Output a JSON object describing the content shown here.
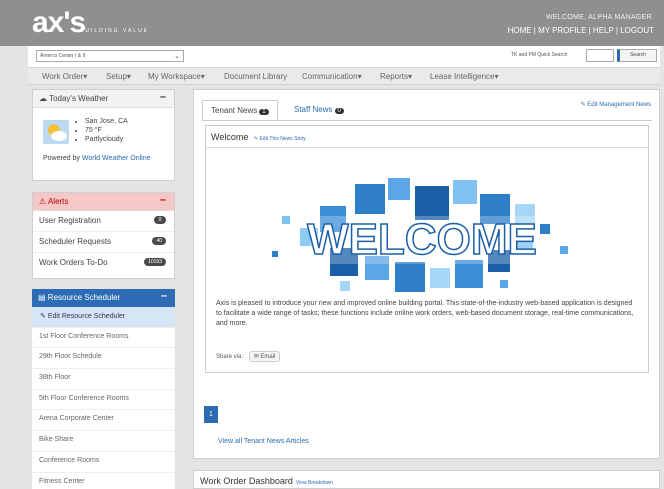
{
  "header": {
    "logo": "ax's",
    "tagline": "BUILDING VALUE",
    "welcome": "WELCOME, ALPHA MANAGER",
    "links": "HOME | MY PROFILE | HELP | LOGOUT"
  },
  "toolbar": {
    "property_select": "Amerco Center I & II",
    "quick_search_label": "TK and PM Quick Search",
    "quick_search_value": "",
    "search_button": "Search"
  },
  "nav": {
    "items": [
      "Work Order▾",
      "Setup▾",
      "My Workspace▾",
      "Document Library",
      "Communication▾",
      "Reports▾",
      "Lease Intelligence▾"
    ]
  },
  "weather": {
    "title": "Today's Weather",
    "city": "San Jose, CA",
    "temp": "75 °F",
    "condition": "Partlycloudy",
    "powered_prefix": "Powered by ",
    "powered_link": "World Weather Online"
  },
  "alerts": {
    "title": "Alerts",
    "items": [
      {
        "label": "User Registration",
        "count": "0"
      },
      {
        "label": "Scheduler Requests",
        "count": "40"
      },
      {
        "label": "Work Orders To-Do",
        "count": "10193"
      }
    ]
  },
  "scheduler": {
    "title": "Resource Scheduler",
    "edit": "Edit Resource Scheduler",
    "items": [
      "1st Floor Conference Rooms",
      "29th Floor Schedule",
      "38th Floor",
      "5th Floor Conference Rooms",
      "Arena Corporate Center",
      "Bike Share",
      "Conference Rooms",
      "Fitness Center"
    ]
  },
  "news": {
    "tab1": "Tenant News",
    "tab1_count": "1",
    "tab2": "Staff News",
    "tab2_count": "0",
    "edit_mgmt": "Edit Management News",
    "story_title": "Welcome",
    "edit_story": "Edit This News Story",
    "graphic_text": "WELCOME",
    "body": "Axis is pleased to introduce your new and improved online building portal. This state-of-the-industry web-based application is designed to facilitate a wide range of tasks; these functions include online work orders, web-based document storage, real-time communications, and more.",
    "share_label": "Share via:",
    "email_btn": "Email",
    "page": "1",
    "view_all": "View all Tenant News Articles"
  },
  "dashboard": {
    "title": "Work Order Dashboard",
    "breakdown": "View Breakdown"
  },
  "colors": {
    "accent": "#2d6cb5",
    "header": "#8f8f8f",
    "alert": "#f5c7c7"
  }
}
